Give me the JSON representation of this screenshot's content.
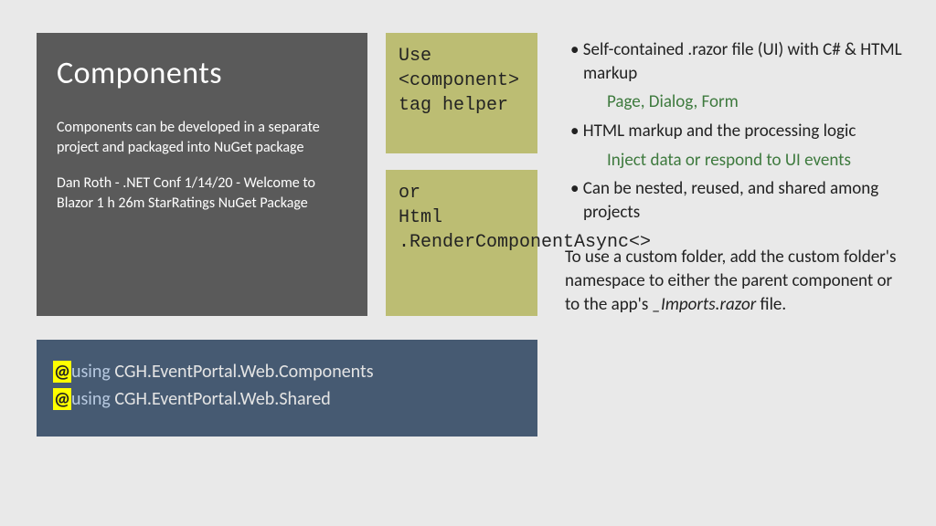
{
  "title_box": {
    "heading": "Components",
    "description": "Components can be developed in a separate project and packaged into NuGet package",
    "attribution": "Dan Roth - .NET Conf 1/14/20 - Welcome to Blazor 1 h 26m StarRatings NuGet Package"
  },
  "olive": {
    "box1_line1": "Use",
    "box1_line2": "<component>",
    "box1_line3": "tag helper",
    "box2_line1": "or",
    "box2_line2": "Html",
    "box2_line3": ".RenderComponentAsync<>"
  },
  "right": {
    "b1_main": "Self-contained .razor file  (UI) with C# & HTML markup",
    "b1_sub": "Page, Dialog, Form",
    "b2_main": "HTML markup and the processing logic",
    "b2_sub": "Inject data or respond to UI events",
    "b3_main": "Can be nested, reused, and shared among projects",
    "custom_note_pre": "To use a custom folder, add the custom folder's namespace to either the parent component or to the app's ",
    "custom_note_em": "_Imports.razor",
    "custom_note_post": " file."
  },
  "code": {
    "at": "@",
    "kw": "using",
    "ns1": " CGH.EventPortal.Web.Components",
    "ns2": " CGH.EventPortal.Web.Shared"
  }
}
